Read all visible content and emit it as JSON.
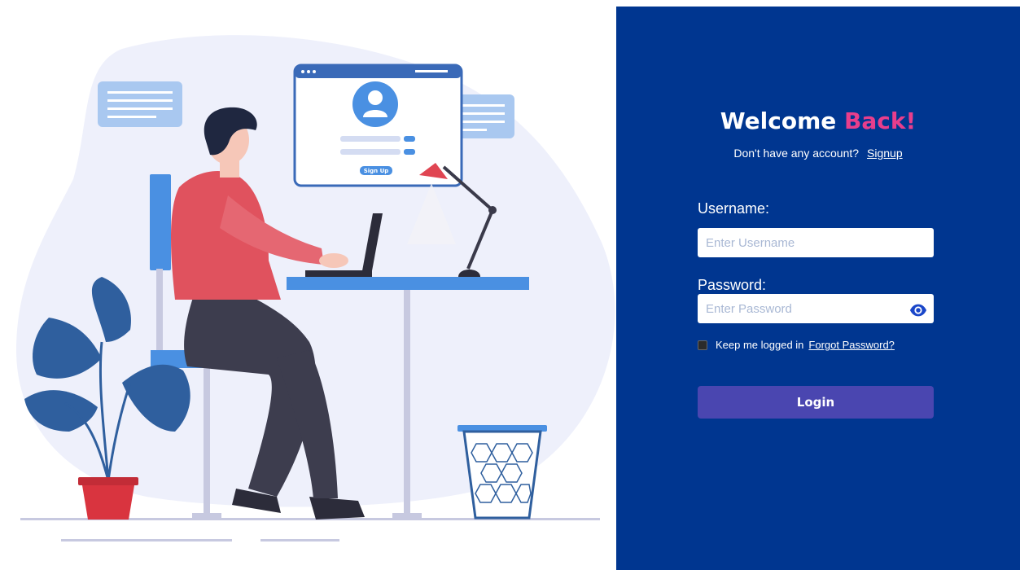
{
  "login": {
    "title_part1": "Welcome",
    "title_part2": "Back!",
    "subtitle": "Don't have any account?",
    "signup_link": "Signup",
    "username_label": "Username:",
    "username_placeholder": "Enter Username",
    "password_label": "Password:",
    "password_placeholder": "Enter Password",
    "remember_label": "Keep me logged in",
    "forgot_link": "Forgot Password?",
    "login_button": "Login"
  },
  "illustration": {
    "screen_button": "Sign Up"
  },
  "colors": {
    "panel_bg": "#003690",
    "accent": "#e83e8c",
    "button": "#4a46b0"
  },
  "icons": {
    "password_toggle": "eye-icon"
  }
}
